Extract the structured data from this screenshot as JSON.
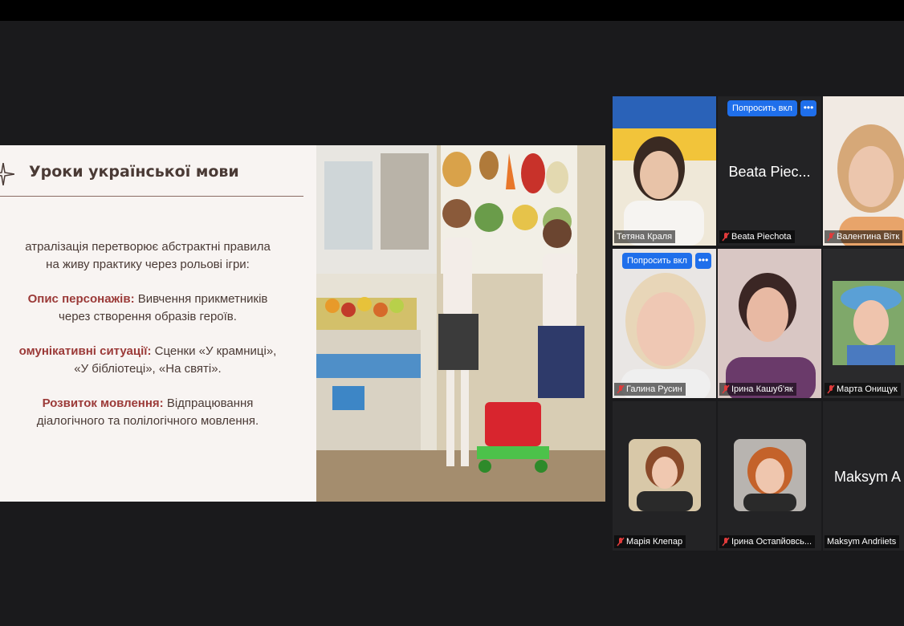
{
  "slide": {
    "title": "Уроки української мови",
    "intro_line1": "атралізація перетворює абстрактні правила",
    "intro_line2": "на живу практику через рольові ігри:",
    "item1_keyword": "Опис персонажів:",
    "item1_text": " Вивчення прикметників",
    "item1_line2": "через створення образів героїв.",
    "item2_keyword": "омунікативні ситуації:",
    "item2_text": " Сценки «У крамниці»,",
    "item2_line2": "«У бібліотеці», «На святі».",
    "item3_keyword": "Розвиток мовлення:",
    "item3_text": " Відпрацювання",
    "item3_line2": "діалогічного та полілогічного мовлення."
  },
  "participants": [
    {
      "name": "Тетяна Краля",
      "muted": false,
      "active": true
    },
    {
      "name": "Beata Piechota",
      "big_name": "Beata Piec...",
      "muted": true,
      "ask_label": "Попросить вкл",
      "more_label": "•••"
    },
    {
      "name": "Валентина Вітк",
      "muted": true
    },
    {
      "name": "Галина Русин",
      "muted": true,
      "ask_label": "Попросить вкл",
      "more_label": "•••"
    },
    {
      "name": "Ірина Кашуб'як",
      "muted": true
    },
    {
      "name": "Марта Онищук",
      "muted": true
    },
    {
      "name": "Марія Клепар",
      "muted": true
    },
    {
      "name": "Ірина Остапйовсь...",
      "muted": true
    },
    {
      "name": "Maksym Andriiets",
      "big_name": "Maksym A",
      "muted": false
    }
  ],
  "colors": {
    "background": "#1a1a1c",
    "slide_bg": "#f8f4f2",
    "keyword": "#9b3a38",
    "active_speaker": "#4cd964",
    "ask_button": "#1f6feb"
  }
}
